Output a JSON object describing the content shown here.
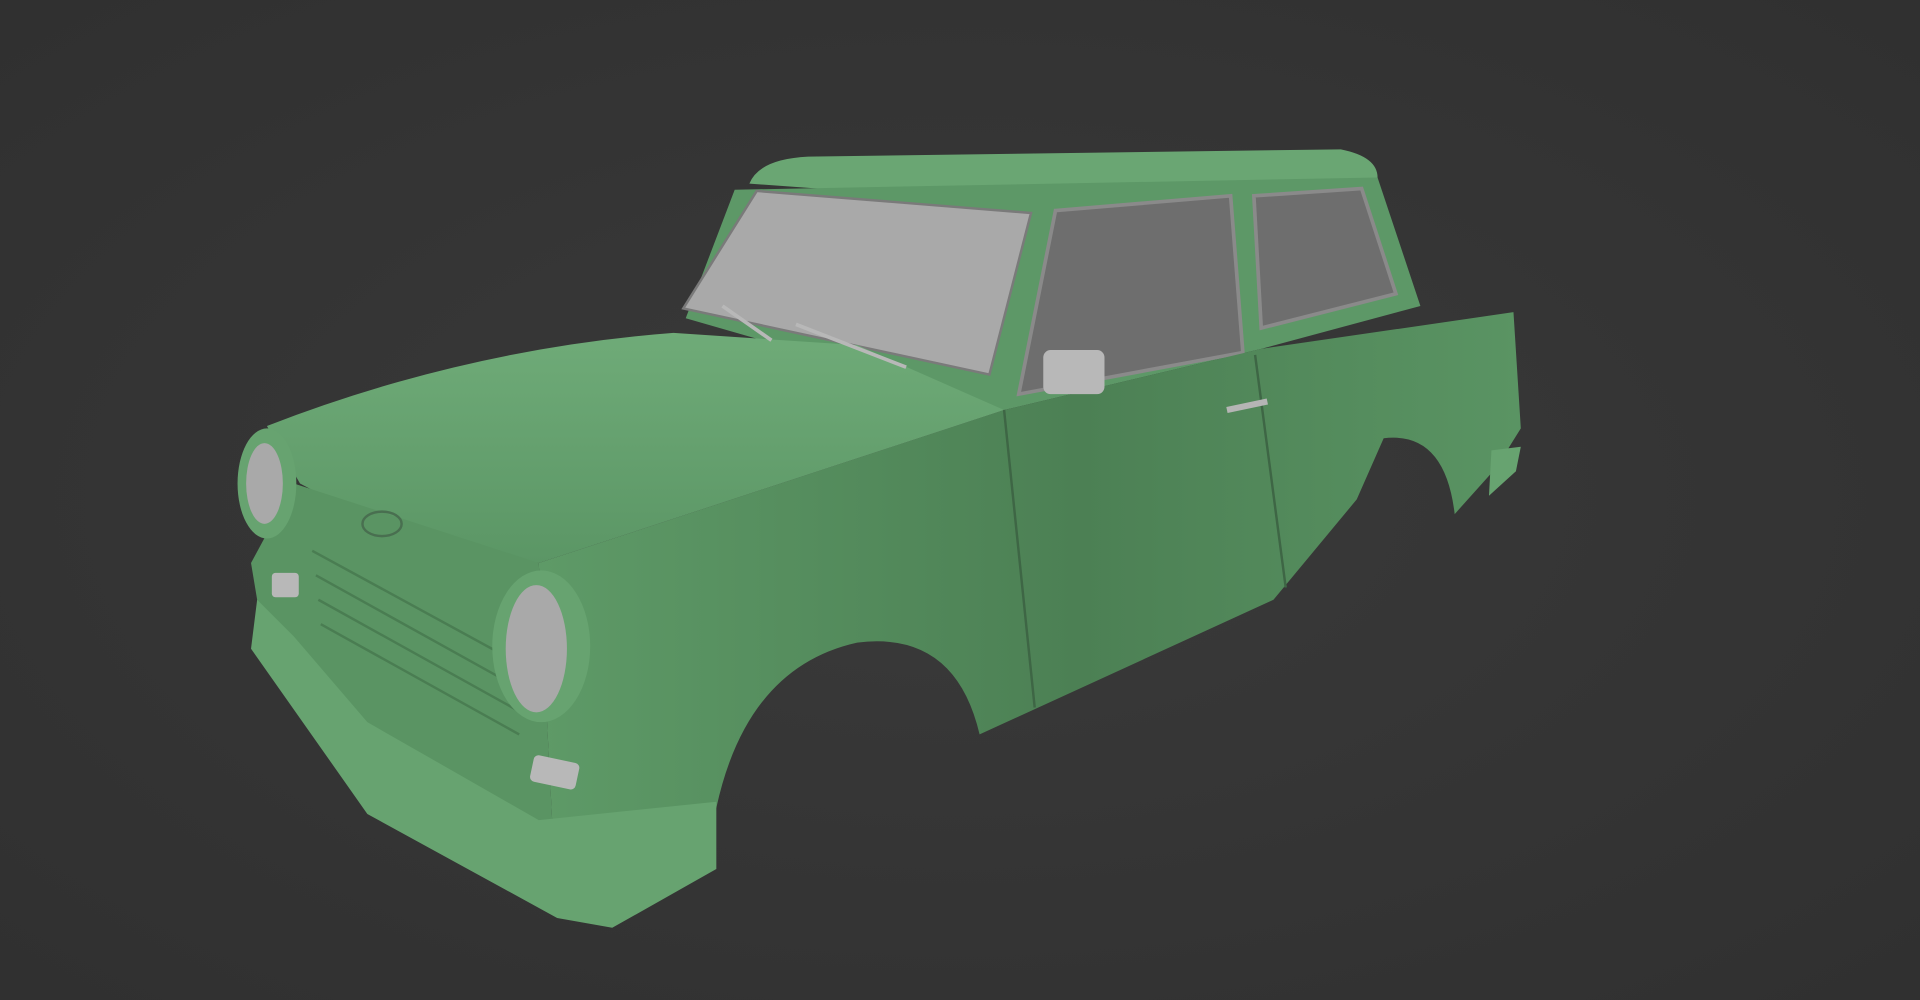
{
  "scene": {
    "subject": "car-body-model",
    "colors": {
      "background": "#353535",
      "body": "#5f9c69",
      "body_light": "#73b07c",
      "body_dark": "#3f6b47",
      "glass_front": "#a9a9a9",
      "glass_side": "#6e6e6e",
      "chrome": "#b8b8b8"
    }
  }
}
